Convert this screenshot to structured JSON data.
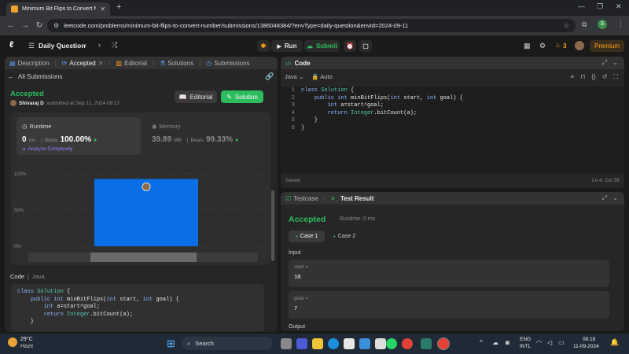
{
  "browser": {
    "tab_title": "Minimum Bit Flips to Convert N",
    "url": "leetcode.com/problems/minimum-bit-flips-to-convert-number/submissions/1386048384/?envType=daily-question&envId=2024-09-11"
  },
  "lcnav": {
    "title": "Daily Question",
    "run": "Run",
    "submit": "Submit",
    "streak": "3",
    "premium": "Premium"
  },
  "left": {
    "tabs": [
      "Description",
      "Accepted",
      "Editorial",
      "Solutions",
      "Submissions"
    ],
    "back": "All Submissions",
    "status": "Accepted",
    "user": "Shivaraj D",
    "submitted": "submitted at Sep 11, 2024 08:17",
    "btn_editorial": "Editorial",
    "btn_solution": "Solution",
    "runtime_label": "Runtime",
    "runtime_value": "0",
    "runtime_unit": "ms",
    "beats_label": "Beats",
    "runtime_beats": "100.00%",
    "analyze": "Analyze Complexity",
    "memory_label": "Memory",
    "memory_value": "39.89",
    "memory_unit": "MB",
    "memory_beats": "99.33%",
    "code_label": "Code",
    "code_lang": "Java"
  },
  "chart_data": {
    "type": "bar",
    "yticks": [
      "100%",
      "50%",
      "0%"
    ],
    "ylim": [
      0,
      100
    ],
    "values": [
      93
    ]
  },
  "code": {
    "title": "Code",
    "lang": "Java",
    "auto": "Auto",
    "lines": [
      "class Solution {",
      "    public int minBitFlips(int start, int goal) {",
      "        int a=start^goal;",
      "        return Integer.bitCount(a);",
      "    }",
      "}"
    ],
    "line_numbers": [
      "1",
      "2",
      "3",
      "4",
      "5",
      "6"
    ],
    "saved": "Saved",
    "cursor": "Ln 4, Col 36"
  },
  "result": {
    "tab_testcase": "Testcase",
    "tab_result": "Test Result",
    "status": "Accepted",
    "runtime": "Runtime: 0 ms",
    "case1": "Case 1",
    "case2": "Case 2",
    "input_label": "Input",
    "var1_name": "start =",
    "var1_value": "10",
    "var2_name": "goal =",
    "var2_value": "7",
    "output_label": "Output"
  },
  "taskbar": {
    "temp": "29°C",
    "weather": "Haze",
    "search": "Search",
    "lang1": "ENG",
    "lang2": "INTL",
    "time": "08:18",
    "date": "11-09-2024"
  },
  "colors": {
    "accent_green": "#2cbb5d",
    "bar_blue": "#0a6ee6",
    "orange": "#ffa116"
  }
}
